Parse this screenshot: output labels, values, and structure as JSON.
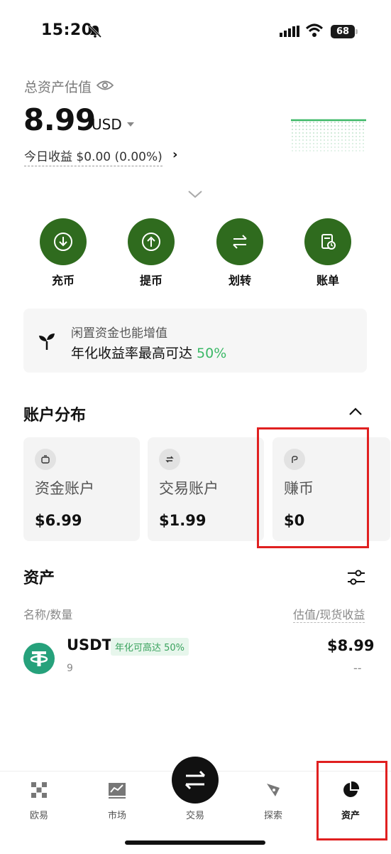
{
  "status_bar": {
    "time": "15:20",
    "battery": "68"
  },
  "header": {
    "total_label": "总资产估值",
    "balance": "8.99",
    "currency": "USD",
    "pnl_label": "今日收益 $0.00 (0.00%)"
  },
  "actions": [
    {
      "label": "充币",
      "icon": "deposit-icon"
    },
    {
      "label": "提币",
      "icon": "withdraw-icon"
    },
    {
      "label": "划转",
      "icon": "transfer-icon"
    },
    {
      "label": "账单",
      "icon": "bill-icon"
    }
  ],
  "promo": {
    "line1": "闲置资金也能增值",
    "line2_prefix": "年化收益率最高可达 ",
    "line2_highlight": "50%"
  },
  "distribution": {
    "title": "账户分布",
    "accounts": [
      {
        "name": "资金账户",
        "value": "$6.99"
      },
      {
        "name": "交易账户",
        "value": "$1.99"
      },
      {
        "name": "赚币",
        "value": "$0"
      }
    ]
  },
  "assets": {
    "title": "资产",
    "col_left": "名称/数量",
    "col_right": "估值/现货收益",
    "items": [
      {
        "symbol": "USDT",
        "tag": "年化可高达 50%",
        "qty": "9",
        "value": "$8.99",
        "pnl": "--"
      }
    ]
  },
  "nav": {
    "items": [
      "欧易",
      "市场",
      "交易",
      "探索",
      "资产"
    ]
  },
  "colors": {
    "accent_green": "#2f6b1e",
    "highlight_green": "#3bb866",
    "annotation_red": "#e02020",
    "usdt_green": "#26a17b"
  }
}
